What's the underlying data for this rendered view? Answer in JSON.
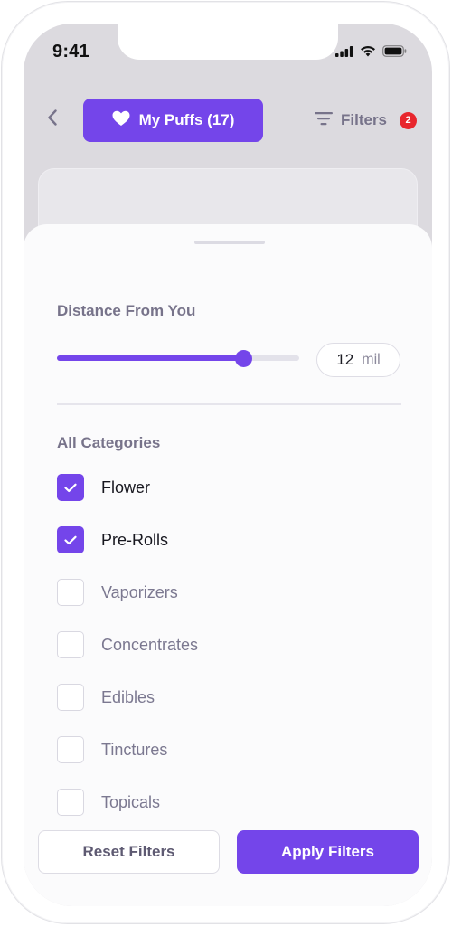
{
  "status_bar": {
    "time": "9:41",
    "icons": [
      "cellular-signal-icon",
      "wifi-icon",
      "battery-icon"
    ]
  },
  "header": {
    "back_icon": "chevron-left-icon",
    "puffs_button": {
      "icon": "heart-icon",
      "label": "My Puffs (17)"
    },
    "filters_button": {
      "icon": "filter-lines-icon",
      "label": "Filters",
      "badge": "2"
    }
  },
  "filter_sheet": {
    "distance": {
      "title": "Distance From You",
      "slider_level": 0.77,
      "value": "12",
      "unit": "mil"
    },
    "categories": {
      "title": "All Categories",
      "items": [
        {
          "label": "Flower",
          "checked": true
        },
        {
          "label": "Pre-Rolls",
          "checked": true
        },
        {
          "label": "Vaporizers",
          "checked": false
        },
        {
          "label": "Concentrates",
          "checked": false
        },
        {
          "label": "Edibles",
          "checked": false
        },
        {
          "label": "Tinctures",
          "checked": false
        },
        {
          "label": "Topicals",
          "checked": false
        }
      ]
    },
    "actions": {
      "reset_label": "Reset Filters",
      "apply_label": "Apply Filters"
    }
  },
  "colors": {
    "accent": "#7445ea",
    "badge": "#e8262d",
    "muted_text": "#77738a",
    "sheet_bg": "#fbfbfc",
    "backdrop": "#dcdadf"
  }
}
